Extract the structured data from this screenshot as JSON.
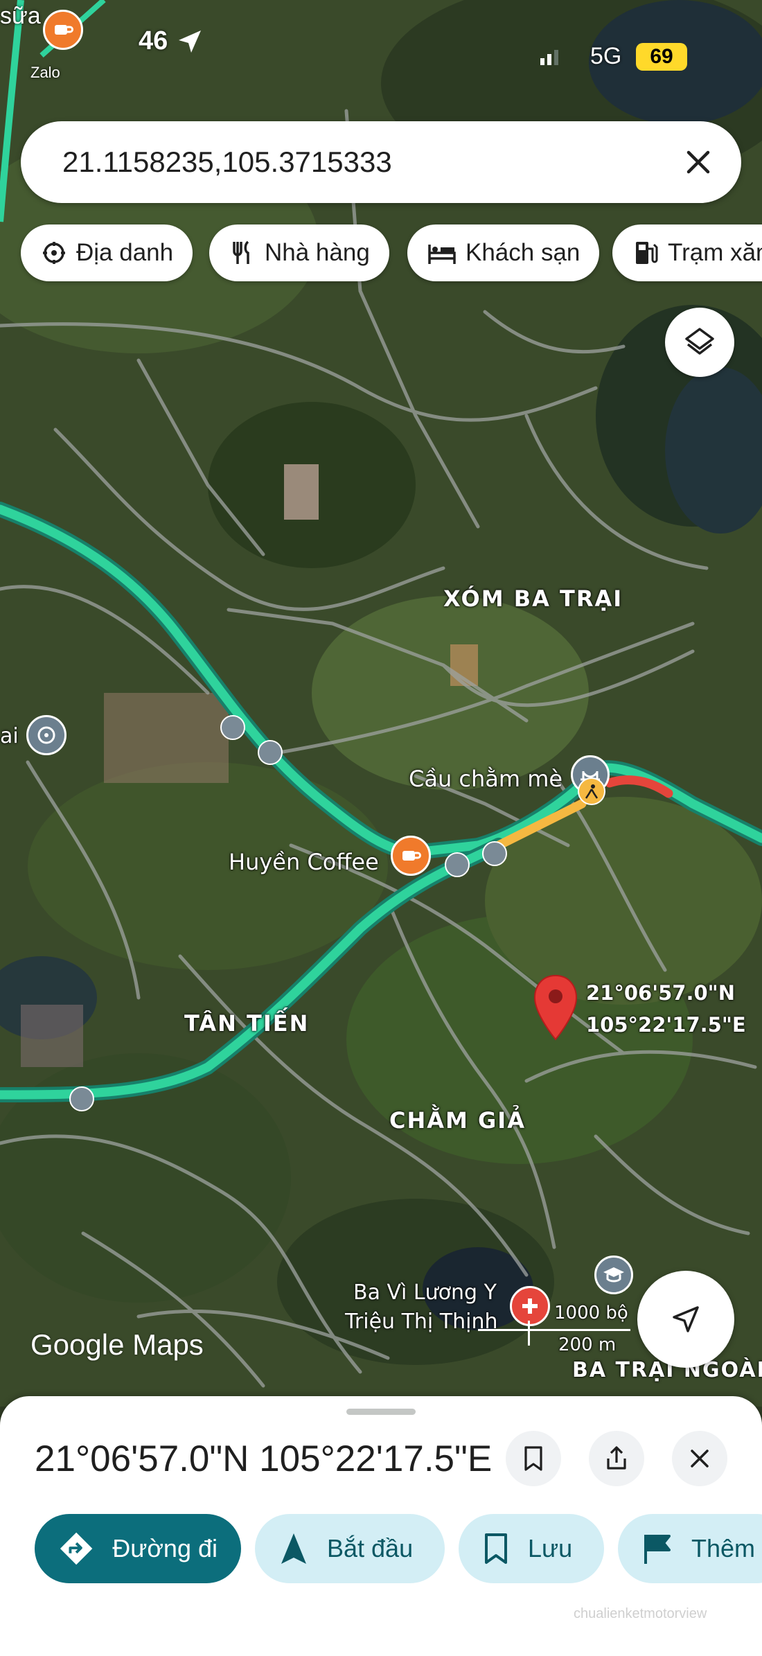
{
  "status_bar": {
    "notification_text": "sữa",
    "notification_sub": "Zalo",
    "network_left": "46",
    "network": "5G",
    "battery": "69"
  },
  "search": {
    "query": "21.1158235,105.3715333"
  },
  "chips": [
    {
      "label": "Địa danh",
      "icon": "attraction-icon"
    },
    {
      "label": "Nhà hàng",
      "icon": "restaurant-icon"
    },
    {
      "label": "Khách sạn",
      "icon": "hotel-icon"
    },
    {
      "label": "Trạm xăn",
      "icon": "gas-station-icon"
    }
  ],
  "map": {
    "area_labels": {
      "xom_ba_trai": "XÓM BA TRẠI",
      "tan_tien": "TÂN TIẾN",
      "cham_gia": "CHẰM GIẢ",
      "ba_trai_ngoai": "BA TRẠI NGOÀI"
    },
    "poi_labels": {
      "cau": "Cầu chằm mè",
      "coffee": "Huyền Coffee",
      "hospital_line1": "Ba Vì Lương Y",
      "hospital_line2": "Triệu Thị Thịnh",
      "left_edge": "ai"
    },
    "pin_coords": {
      "lat": "21°06'57.0\"N",
      "lng": "105°22'17.5\"E"
    },
    "scale": {
      "feet": "1000 bộ",
      "meters": "200 m"
    },
    "logo": "Google Maps",
    "colors": {
      "route": "#2fd39c",
      "traffic_slow": "#f5b841",
      "traffic_heavy": "#e5453b",
      "pin": "#e53935"
    }
  },
  "sheet": {
    "title": "21°06'57.0\"N 105°22'17.5\"E",
    "actions": {
      "directions": "Đường đi",
      "start": "Bắt đầu",
      "save": "Lưu",
      "more": "Thêm"
    }
  },
  "watermark": "chualienketmotorview"
}
